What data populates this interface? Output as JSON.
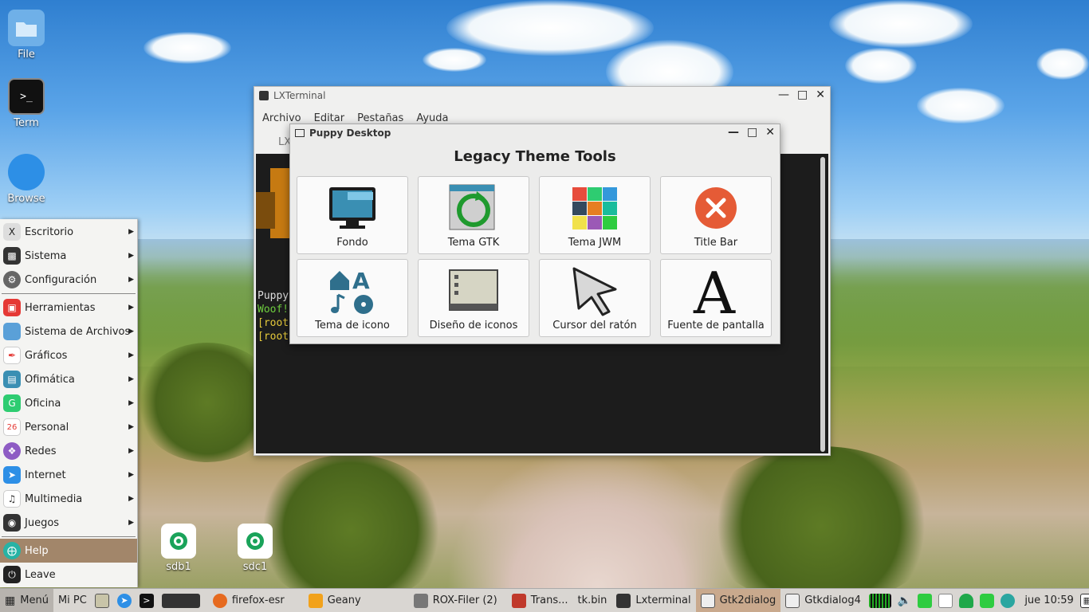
{
  "desktop": {
    "icons": [
      {
        "label": "File"
      },
      {
        "label": "Term"
      },
      {
        "label": "Browse"
      },
      {
        "label": "sdb1"
      },
      {
        "label": "sdc1"
      }
    ]
  },
  "menu": {
    "items": [
      {
        "label": "Escritorio"
      },
      {
        "label": "Sistema"
      },
      {
        "label": "Configuración"
      },
      {
        "label": "Herramientas"
      },
      {
        "label": "Sistema de Archivos"
      },
      {
        "label": "Gráficos"
      },
      {
        "label": "Ofimática"
      },
      {
        "label": "Oficina"
      },
      {
        "label": "Personal"
      },
      {
        "label": "Redes"
      },
      {
        "label": "Internet"
      },
      {
        "label": "Multimedia"
      },
      {
        "label": "Juegos"
      },
      {
        "label": "Help"
      },
      {
        "label": "Leave"
      }
    ]
  },
  "lxterminal": {
    "title": "LXTerminal",
    "menus": [
      "Archivo",
      "Editar",
      "Pestañas",
      "Ayuda"
    ],
    "tab_partial": "LX",
    "lines": [
      "Puppy",
      "Woof!",
      "[root",
      "[root"
    ]
  },
  "tools": {
    "window_title": "Puppy Desktop",
    "heading": "Legacy Theme Tools",
    "tiles": [
      {
        "label": "Fondo"
      },
      {
        "label": "Tema GTK"
      },
      {
        "label": "Tema JWM"
      },
      {
        "label": "Title Bar"
      },
      {
        "label": "Tema de icono"
      },
      {
        "label": "Diseño de iconos"
      },
      {
        "label": "Cursor del ratón"
      },
      {
        "label": "Fuente de pantalla"
      }
    ]
  },
  "taskbar": {
    "menu_label": "Menú",
    "mipc_label": "Mi PC",
    "tasks": [
      {
        "label": "firefox-esr"
      },
      {
        "label": "Geany"
      },
      {
        "label": "ROX-Filer (2)"
      },
      {
        "label": "Trans..."
      },
      {
        "label": "tk.bin"
      },
      {
        "label": "Lxterminal"
      },
      {
        "label": "Gtk2dialog"
      },
      {
        "label": "Gtkdialog4"
      }
    ],
    "clock": "jue 10:59"
  }
}
